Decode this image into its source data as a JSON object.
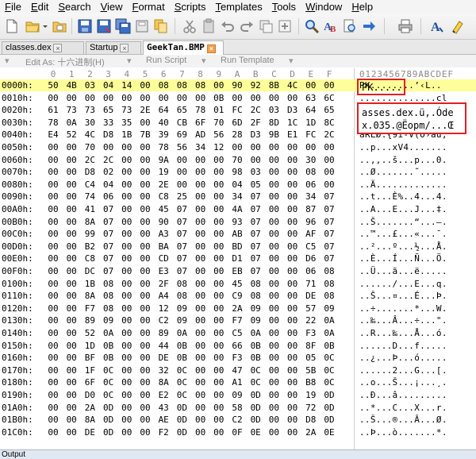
{
  "menu": [
    "File",
    "Edit",
    "Search",
    "View",
    "Format",
    "Scripts",
    "Templates",
    "Tools",
    "Window",
    "Help"
  ],
  "toolbar": {
    "icons": [
      "new-file",
      "open-folder",
      "open-folder-dropdown",
      "save",
      "save-as",
      "save-all",
      "print-disabled",
      "undo",
      "redo",
      "find",
      "replace",
      "find-binary",
      "go-arrow",
      "printer",
      "font",
      "highlighter"
    ]
  },
  "tabs": [
    {
      "label": "classes.dex",
      "active": false
    },
    {
      "label": "Startup",
      "active": false
    },
    {
      "label": "GeekTan.BMP",
      "active": true
    }
  ],
  "editbar": {
    "edit_as": "Edit As: 十六进制(H)",
    "run_script": "Run Script",
    "run_template": "Run Template"
  },
  "columns": [
    "0",
    "1",
    "2",
    "3",
    "4",
    "5",
    "6",
    "7",
    "8",
    "9",
    "A",
    "B",
    "C",
    "D",
    "E",
    "F"
  ],
  "ascii_header": "0123456789ABCDEF",
  "rows": [
    {
      "addr": "0000h:",
      "hex": [
        "50",
        "4B",
        "03",
        "04",
        "14",
        "00",
        "08",
        "08",
        "08",
        "00",
        "90",
        "92",
        "8B",
        "4C",
        "00",
        "00"
      ],
      "ascii": "PK........’‹L.."
    },
    {
      "addr": "0010h:",
      "hex": [
        "00",
        "00",
        "00",
        "00",
        "00",
        "00",
        "00",
        "00",
        "00",
        "0B",
        "00",
        "00",
        "00",
        "00",
        "63",
        "6C"
      ],
      "ascii": "..............cl"
    },
    {
      "addr": "0020h:",
      "hex": [
        "61",
        "73",
        "73",
        "65",
        "73",
        "2E",
        "64",
        "65",
        "78",
        "01",
        "FC",
        "2C",
        "03",
        "D3",
        "64",
        "65"
      ],
      "ascii": "asses.dex.ü,.Óde"
    },
    {
      "addr": "0030h:",
      "hex": [
        "78",
        "0A",
        "30",
        "33",
        "35",
        "00",
        "40",
        "CB",
        "6F",
        "70",
        "6D",
        "2F",
        "8D",
        "1C",
        "1D",
        "8C"
      ],
      "ascii": "x.035.@Ëopm/...Œ"
    },
    {
      "addr": "0040h:",
      "hex": [
        "E4",
        "52",
        "4C",
        "D8",
        "1B",
        "7B",
        "39",
        "69",
        "AD",
        "56",
        "28",
        "D3",
        "9B",
        "E1",
        "FC",
        "2C"
      ],
      "ascii": "äRLØ.{9i-V(Ó›áü,"
    },
    {
      "addr": "0050h:",
      "hex": [
        "00",
        "00",
        "70",
        "00",
        "00",
        "00",
        "78",
        "56",
        "34",
        "12",
        "00",
        "00",
        "00",
        "00",
        "00",
        "00"
      ],
      "ascii": "..p...xV4......."
    },
    {
      "addr": "0060h:",
      "hex": [
        "00",
        "00",
        "2C",
        "2C",
        "00",
        "00",
        "9A",
        "00",
        "00",
        "00",
        "70",
        "00",
        "00",
        "00",
        "30",
        "00"
      ],
      "ascii": "..,,..š...p...0."
    },
    {
      "addr": "0070h:",
      "hex": [
        "00",
        "00",
        "D8",
        "02",
        "00",
        "00",
        "19",
        "00",
        "00",
        "00",
        "98",
        "03",
        "00",
        "00",
        "08",
        "00"
      ],
      "ascii": "..Ø.......˜....."
    },
    {
      "addr": "0080h:",
      "hex": [
        "00",
        "00",
        "C4",
        "04",
        "00",
        "00",
        "2E",
        "00",
        "00",
        "00",
        "04",
        "05",
        "00",
        "00",
        "06",
        "00"
      ],
      "ascii": "..Ä............."
    },
    {
      "addr": "0090h:",
      "hex": [
        "00",
        "00",
        "74",
        "06",
        "00",
        "00",
        "C8",
        "25",
        "00",
        "00",
        "34",
        "07",
        "00",
        "00",
        "34",
        "07"
      ],
      "ascii": "..t...È%..4...4."
    },
    {
      "addr": "00A0h:",
      "hex": [
        "00",
        "00",
        "41",
        "07",
        "00",
        "00",
        "45",
        "07",
        "00",
        "00",
        "4A",
        "07",
        "00",
        "00",
        "87",
        "07"
      ],
      "ascii": "..A...E...J...‡."
    },
    {
      "addr": "00B0h:",
      "hex": [
        "00",
        "00",
        "8A",
        "07",
        "00",
        "00",
        "90",
        "07",
        "00",
        "00",
        "93",
        "07",
        "00",
        "00",
        "96",
        "07"
      ],
      "ascii": "..Š.......“...–."
    },
    {
      "addr": "00C0h:",
      "hex": [
        "00",
        "00",
        "99",
        "07",
        "00",
        "00",
        "A3",
        "07",
        "00",
        "00",
        "AB",
        "07",
        "00",
        "00",
        "AF",
        "07"
      ],
      "ascii": "..™...£...«...¯."
    },
    {
      "addr": "00D0h:",
      "hex": [
        "00",
        "00",
        "B2",
        "07",
        "00",
        "00",
        "BA",
        "07",
        "00",
        "00",
        "BD",
        "07",
        "00",
        "00",
        "C5",
        "07"
      ],
      "ascii": "..²...º...½...Å."
    },
    {
      "addr": "00E0h:",
      "hex": [
        "00",
        "00",
        "C8",
        "07",
        "00",
        "00",
        "CD",
        "07",
        "00",
        "00",
        "D1",
        "07",
        "00",
        "00",
        "D6",
        "07"
      ],
      "ascii": "..È...Í...Ñ...Ö."
    },
    {
      "addr": "00F0h:",
      "hex": [
        "00",
        "00",
        "DC",
        "07",
        "00",
        "00",
        "E3",
        "07",
        "00",
        "00",
        "EB",
        "07",
        "00",
        "00",
        "06",
        "08"
      ],
      "ascii": "..Ü...ã...ë....."
    },
    {
      "addr": "0100h:",
      "hex": [
        "00",
        "00",
        "1B",
        "08",
        "00",
        "00",
        "2F",
        "08",
        "00",
        "00",
        "45",
        "08",
        "00",
        "00",
        "71",
        "08"
      ],
      "ascii": "....../...E...q."
    },
    {
      "addr": "0110h:",
      "hex": [
        "00",
        "00",
        "8A",
        "08",
        "00",
        "00",
        "A4",
        "08",
        "00",
        "00",
        "C9",
        "08",
        "00",
        "00",
        "DE",
        "08"
      ],
      "ascii": "..Š...¤...É...Þ."
    },
    {
      "addr": "0120h:",
      "hex": [
        "00",
        "00",
        "F7",
        "08",
        "00",
        "00",
        "12",
        "09",
        "00",
        "00",
        "2A",
        "09",
        "00",
        "00",
        "57",
        "09"
      ],
      "ascii": "..÷.......*...W."
    },
    {
      "addr": "0130h:",
      "hex": [
        "00",
        "00",
        "89",
        "09",
        "00",
        "00",
        "C2",
        "09",
        "00",
        "00",
        "F7",
        "09",
        "00",
        "00",
        "22",
        "0A"
      ],
      "ascii": "..‰...Â...÷...\"."
    },
    {
      "addr": "0140h:",
      "hex": [
        "00",
        "00",
        "52",
        "0A",
        "00",
        "00",
        "89",
        "0A",
        "00",
        "00",
        "C5",
        "0A",
        "00",
        "00",
        "F3",
        "0A"
      ],
      "ascii": "..R...‰...Å...ó."
    },
    {
      "addr": "0150h:",
      "hex": [
        "00",
        "00",
        "1D",
        "0B",
        "00",
        "00",
        "44",
        "0B",
        "00",
        "00",
        "66",
        "0B",
        "00",
        "00",
        "8F",
        "0B"
      ],
      "ascii": "......D...f....."
    },
    {
      "addr": "0160h:",
      "hex": [
        "00",
        "00",
        "BF",
        "0B",
        "00",
        "00",
        "DE",
        "0B",
        "00",
        "00",
        "F3",
        "0B",
        "00",
        "00",
        "05",
        "0C"
      ],
      "ascii": "..¿...Þ...ó....."
    },
    {
      "addr": "0170h:",
      "hex": [
        "00",
        "00",
        "1F",
        "0C",
        "00",
        "00",
        "32",
        "0C",
        "00",
        "00",
        "47",
        "0C",
        "00",
        "00",
        "5B",
        "0C"
      ],
      "ascii": "......2...G...[."
    },
    {
      "addr": "0180h:",
      "hex": [
        "00",
        "00",
        "6F",
        "0C",
        "00",
        "00",
        "8A",
        "0C",
        "00",
        "00",
        "A1",
        "0C",
        "00",
        "00",
        "B8",
        "0C"
      ],
      "ascii": "..o...Š...¡...¸."
    },
    {
      "addr": "0190h:",
      "hex": [
        "00",
        "00",
        "D0",
        "0C",
        "00",
        "00",
        "E2",
        "0C",
        "00",
        "00",
        "09",
        "0D",
        "00",
        "00",
        "19",
        "0D"
      ],
      "ascii": "..Ð...â........."
    },
    {
      "addr": "01A0h:",
      "hex": [
        "00",
        "00",
        "2A",
        "0D",
        "00",
        "00",
        "43",
        "0D",
        "00",
        "00",
        "58",
        "0D",
        "00",
        "00",
        "72",
        "0D"
      ],
      "ascii": "..*...C...X...r."
    },
    {
      "addr": "01B0h:",
      "hex": [
        "00",
        "00",
        "8A",
        "0D",
        "00",
        "00",
        "AE",
        "0D",
        "00",
        "00",
        "C2",
        "0D",
        "00",
        "00",
        "D8",
        "0D"
      ],
      "ascii": "..Š...®...Â...Ø."
    },
    {
      "addr": "01C0h:",
      "hex": [
        "00",
        "00",
        "DE",
        "0D",
        "00",
        "00",
        "F2",
        "0D",
        "00",
        "00",
        "0F",
        "0E",
        "00",
        "00",
        "2A",
        "0E"
      ],
      "ascii": "..Þ...ò.......*."
    }
  ],
  "callouts": {
    "box1_text": "PK.....",
    "box2_line1": "asses.dex.ü,.Óde",
    "box2_line2": "x.035.@Ëopm/...Œ"
  },
  "statusbar": {
    "label": "Output"
  },
  "colors": {
    "highlight_row": "#ffff99",
    "callout_border": "#e02020",
    "status_bg": "#e0e8f3"
  }
}
